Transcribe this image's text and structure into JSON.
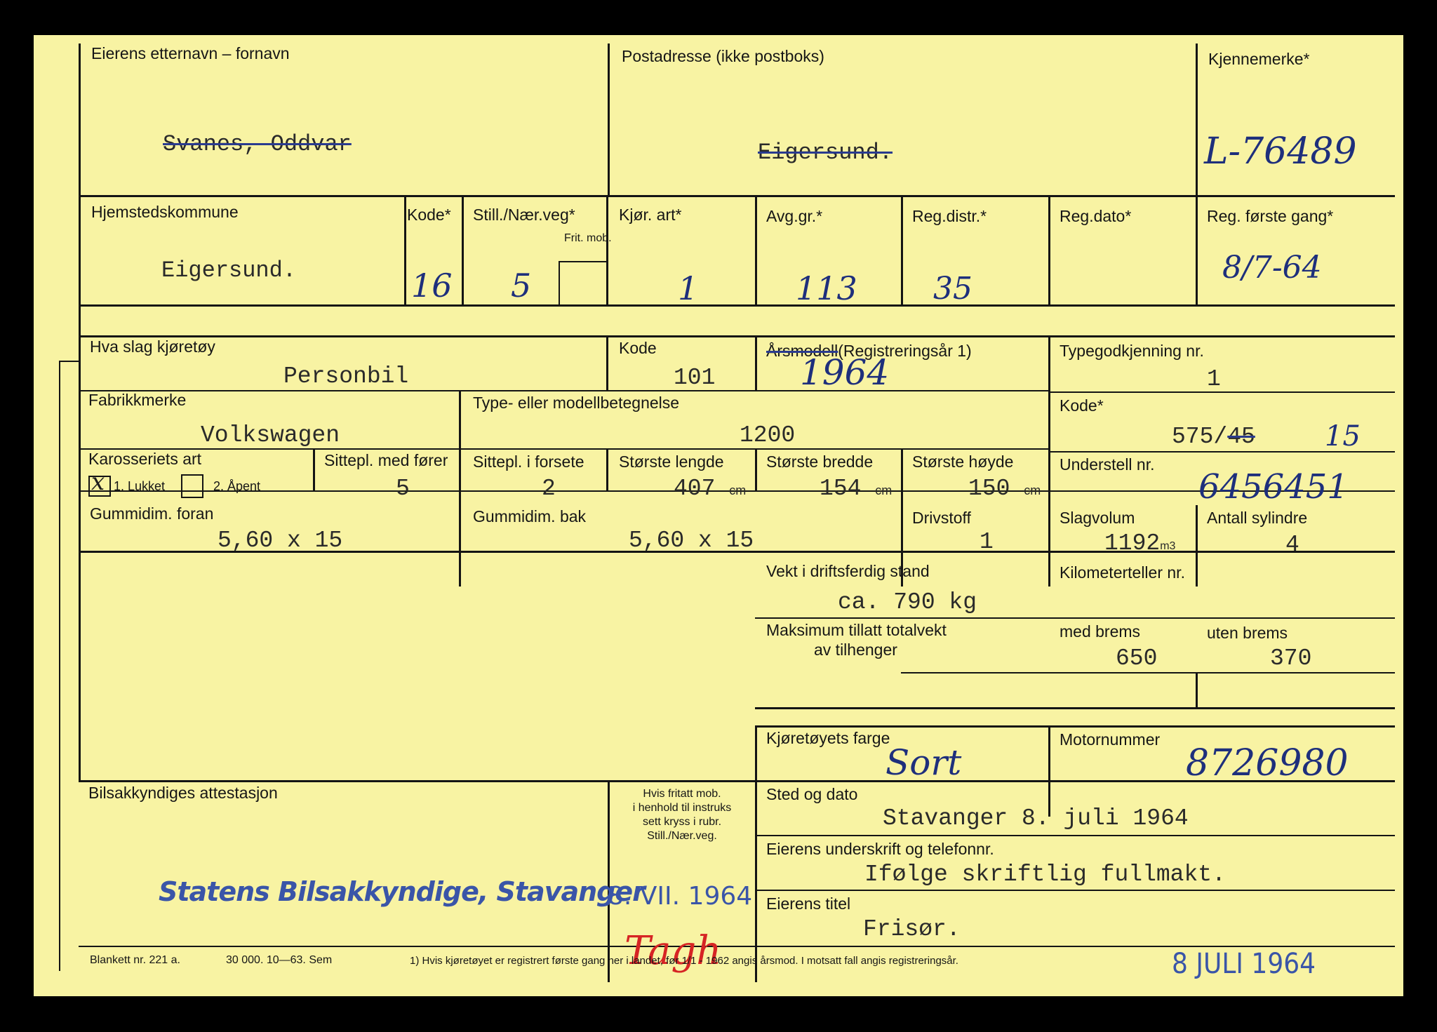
{
  "owner": {
    "name_label": "Eierens etternavn – fornavn",
    "name_value": "Svanes, Oddvar",
    "address_label": "Postadresse (ikke postboks)",
    "address_value": "Eigersund.",
    "plate_label": "Kjennemerke*",
    "plate_value": "L-76489"
  },
  "registration": {
    "municipality_label": "Hjemstedskommune",
    "municipality_value": "Eigersund.",
    "code_label": "Kode*",
    "code_value": "16",
    "still_label": "Still./Nær.veg*",
    "still_value": "5",
    "frit_label": "Frit. mob.",
    "kjor_label": "Kjør. art*",
    "kjor_value": "1",
    "avg_label": "Avg.gr.*",
    "avg_value": "113",
    "distr_label": "Reg.distr.*",
    "distr_value": "35",
    "date_label": "Reg.dato*",
    "first_label": "Reg. første gang*",
    "first_value": "8/7-64"
  },
  "vehicle": {
    "kind_label": "Hva slag kjøretøy",
    "kind_value": "Personbil",
    "kode_label": "Kode",
    "kode_value": "101",
    "year_label_struck": "Årsmodell",
    "year_label_rest": "(Registreringsår 1)",
    "year_value": "1964",
    "type_label": "Typegodkjenning nr.",
    "type_value": "1",
    "make_label": "Fabrikkmerke",
    "make_value": "Volkswagen",
    "model_label": "Type- eller modellbetegnelse",
    "model_value": "1200",
    "kode2_label": "Kode*",
    "kode2_value": "575",
    "kode2_struck": "45",
    "kode2_new": "15",
    "body_label": "Karosseriets art",
    "body_mark": "x",
    "body_opt1": "1. Lukket",
    "body_opt2": "2. Åpent",
    "seats_label": "Sittepl. med fører",
    "seats_value": "5",
    "front_seats_label": "Sittepl. i forsete",
    "front_seats_value": "2",
    "length_label": "Største lengde",
    "length_value": "407",
    "width_label": "Største bredde",
    "width_value": "154",
    "height_label": "Største høyde",
    "height_value": "150",
    "unit_cm": "cm",
    "chassis_label": "Understell nr.",
    "chassis_value": "6456451",
    "tire_front_label": "Gummidim. foran",
    "tire_front_value": "5,60 x 15",
    "tire_rear_label": "Gummidim. bak",
    "tire_rear_value": "5,60 x 15",
    "fuel_label": "Drivstoff",
    "fuel_value": "1",
    "volume_label": "Slagvolum",
    "volume_value": "1192",
    "volume_unit": "m3",
    "cyl_label": "Antall sylindre",
    "cyl_value": "4"
  },
  "weight": {
    "label": "Vekt i driftsferdig stand",
    "value": "ca. 790 kg",
    "km_label": "Kilometerteller nr.",
    "trailer_label_1": "Maksimum tillatt totalvekt",
    "trailer_label_2": "av tilhenger",
    "braked_label": "med brems",
    "braked_value": "650",
    "unbraked_label": "uten brems",
    "unbraked_value": "370"
  },
  "color": {
    "label": "Kjøretøyets farge",
    "value": "Sort",
    "motor_label": "Motornummer",
    "motor_value": "8726980"
  },
  "attest": {
    "label": "Bilsakkyndiges attestasjon",
    "note": "Hvis fritatt mob.\ni henhold til instruks\nsett kryss i rubr.\nStill./Nær.veg.",
    "stamp": "Statens Bilsakkyndige, Stavanger",
    "date_stamp": "8. VII. 1964",
    "signature": "Tagh"
  },
  "place": {
    "label": "Sted og dato",
    "value": "Stavanger 8. juli 1964",
    "sign_label": "Eierens underskrift og telefonnr.",
    "sign_value": "Ifølge skriftlig fullmakt.",
    "title_label": "Eierens titel",
    "title_value": "Frisør."
  },
  "footer": {
    "form_no": "Blankett nr. 221 a.",
    "print": "30 000. 10—63. Sem",
    "note": "1)  Hvis kjøretøyet er registrert første gang her i landet, før 1/1 - 1962 angis årsmod.  I motsatt fall angis registreringsår.",
    "date_stamp": "8 JULI 1964"
  }
}
